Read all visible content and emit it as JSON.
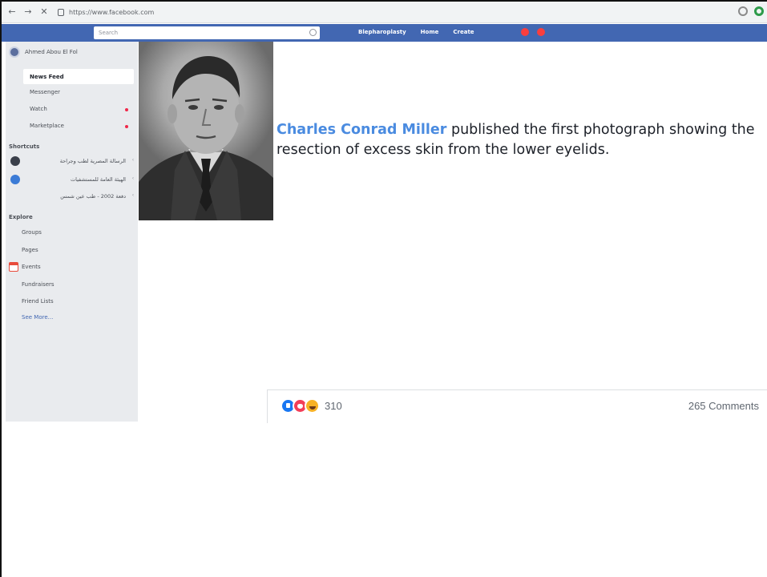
{
  "browser": {
    "back_icon": "←",
    "forward_icon": "→",
    "close_icon": "✕",
    "url": "https://www.facebook.com"
  },
  "fb_header": {
    "search_placeholder": "Search",
    "profile_link": "Blepharoplasty",
    "home_link": "Home",
    "create_link": "Create",
    "brand_color": "#4267b2"
  },
  "sidebar": {
    "user_name": "Ahmed Abou El Fol",
    "items": [
      {
        "label": "News Feed"
      },
      {
        "label": "Messenger"
      },
      {
        "label": "Watch"
      },
      {
        "label": "Marketplace"
      }
    ],
    "shortcuts_heading": "Shortcuts",
    "shortcuts": [
      {
        "label": "الرسالة المصرية لطب وجراحة"
      },
      {
        "label": "الهيئة العامة للمستشفيات"
      },
      {
        "label": "دفعة 2002 - طب عين شمس"
      }
    ],
    "explore_heading": "Explore",
    "explore": [
      {
        "label": "Groups"
      },
      {
        "label": "Pages"
      },
      {
        "label": "Events"
      },
      {
        "label": "Fundraisers"
      },
      {
        "label": "Friend Lists"
      },
      {
        "label": "See More..."
      }
    ]
  },
  "post": {
    "caption_name": "Charles Conrad Miller",
    "caption_rest": " published the first photograph showing the resection of excess skin from the lower eyelids.",
    "reaction_count": "310",
    "comments": "265 Comments"
  }
}
